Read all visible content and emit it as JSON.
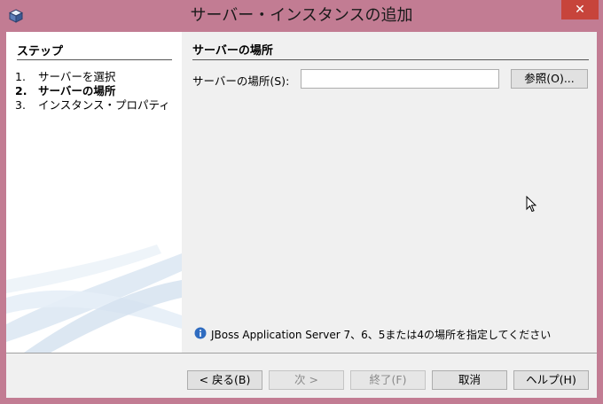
{
  "window": {
    "title": "サーバー・インスタンスの追加",
    "close_label": "✕"
  },
  "steps": {
    "header": "ステップ",
    "items": [
      {
        "num": "1.",
        "label": "サーバーを選択"
      },
      {
        "num": "2.",
        "label": "サーバーの場所"
      },
      {
        "num": "3.",
        "label": "インスタンス・プロパティ"
      }
    ]
  },
  "content": {
    "title": "サーバーの場所",
    "location_label": "サーバーの場所(S):",
    "location_value": "",
    "browse_label": "参照(O)...",
    "info_text": "JBoss Application Server 7、6、5または4の場所を指定してください"
  },
  "buttons": {
    "back": "< 戻る(B)",
    "next": "次 >",
    "finish": "終了(F)",
    "cancel": "取消",
    "help": "ヘルプ(H)"
  },
  "colors": {
    "titlebar": "#c27c93",
    "close": "#c7443b",
    "panel": "#f0f0f0"
  }
}
